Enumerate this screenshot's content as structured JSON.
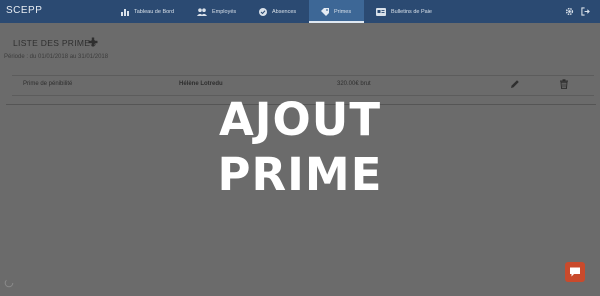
{
  "app": {
    "brand": "SCEPP"
  },
  "nav": {
    "items": [
      {
        "label": "Tableau de Bord",
        "icon": "bar-chart-icon"
      },
      {
        "label": "Employés",
        "icon": "users-icon"
      },
      {
        "label": "Absences",
        "icon": "check-circle-icon"
      },
      {
        "label": "Primes",
        "icon": "tag-icon",
        "active": true
      },
      {
        "label": "Bulletins de Paie",
        "icon": "payslip-icon"
      }
    ]
  },
  "page": {
    "title": "LISTE DES PRIMES",
    "period": "Période : du 01/01/2018 au 31/01/2018"
  },
  "primes": {
    "rows": [
      {
        "type": "Prime de pénibilité",
        "employee": "Hélène Lotredu",
        "amount": "320.00€ brut"
      }
    ]
  },
  "overlay": {
    "line1": "AJOUT",
    "line2": "PRIME"
  },
  "colors": {
    "nav_bg": "#2b4a72",
    "nav_active": "#3d6796",
    "backdrop": "#6b6b6b",
    "chat": "#c94a2c"
  }
}
